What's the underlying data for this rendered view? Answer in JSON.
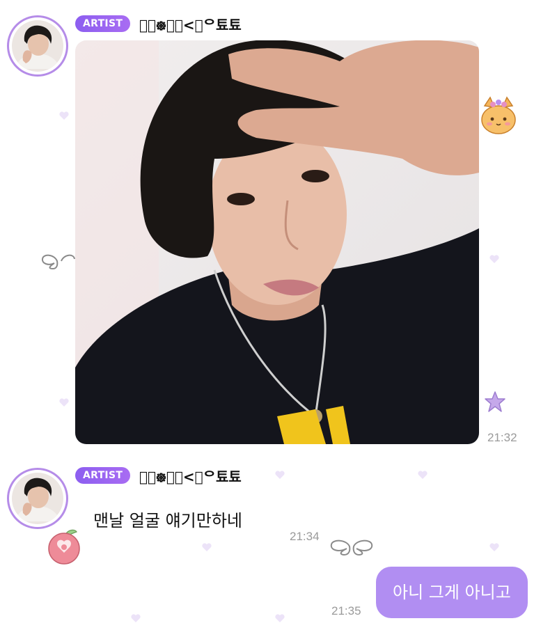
{
  "messages": [
    {
      "badge": "ARTIST",
      "nickname": "ᄋ᳟᪥ᦟ᳟<᳟ᄋ툐툐",
      "time": "21:32"
    },
    {
      "badge": "ARTIST",
      "nickname": "ᄋ᳟᪥ᦟ᳟<᳟ᄋ툐툐",
      "text": "맨날 얼굴 얘기만하네",
      "time": "21:34"
    }
  ],
  "my_message": {
    "text": "아니 그게 아니고",
    "time": "21:35"
  },
  "colors": {
    "accent": "#a86cf2",
    "bubble": "#b18ef2",
    "avatar_ring": "#b58ce8",
    "decor": "#e9dcf7"
  }
}
